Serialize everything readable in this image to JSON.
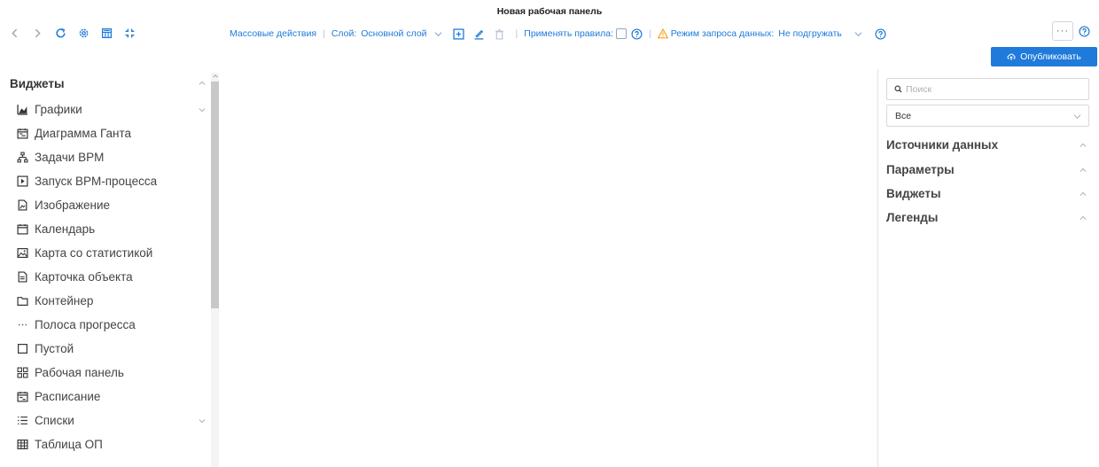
{
  "header": {
    "title": "Новая рабочая панель"
  },
  "toolbar": {
    "nav_icons": [
      "back-icon",
      "forward-icon",
      "refresh-icon",
      "settings-icon",
      "calculator-icon",
      "fullscreen-icon"
    ],
    "bulk_actions": "Массовые действия",
    "layer_label": "Слой:",
    "layer_value": "Основной слой",
    "apply_rules_label": "Применять правила:",
    "data_mode_label": "Режим запроса данных:",
    "data_mode_value": "Не подгружать",
    "more_label": "···",
    "publish_label": "Опубликовать"
  },
  "sidebar": {
    "heading": "Виджеты",
    "items": [
      {
        "label": "Графики",
        "icon": "area-chart-icon",
        "expandable": true
      },
      {
        "label": "Диаграмма Ганта",
        "icon": "gantt-icon"
      },
      {
        "label": "Задачи BPM",
        "icon": "sitemap-icon"
      },
      {
        "label": "Запуск BPM-процесса",
        "icon": "play-square-icon"
      },
      {
        "label": "Изображение",
        "icon": "file-image-icon"
      },
      {
        "label": "Календарь",
        "icon": "calendar-icon"
      },
      {
        "label": "Карта со статистикой",
        "icon": "picture-icon"
      },
      {
        "label": "Карточка объекта",
        "icon": "file-text-icon"
      },
      {
        "label": "Контейнер",
        "icon": "folder-icon"
      },
      {
        "label": "Полоса прогресса",
        "icon": "ellipsis-icon"
      },
      {
        "label": "Пустой",
        "icon": "square-icon"
      },
      {
        "label": "Рабочая панель",
        "icon": "grid-icon"
      },
      {
        "label": "Расписание",
        "icon": "schedule-icon"
      },
      {
        "label": "Списки",
        "icon": "list-icon",
        "expandable": true
      },
      {
        "label": "Таблица ОП",
        "icon": "table-icon"
      }
    ]
  },
  "right_panel": {
    "search_placeholder": "Поиск",
    "filter_value": "Все",
    "sections": [
      "Источники данных",
      "Параметры",
      "Виджеты",
      "Легенды"
    ]
  },
  "colors": {
    "accent": "#1f7ad9",
    "warning": "#f5a623"
  }
}
